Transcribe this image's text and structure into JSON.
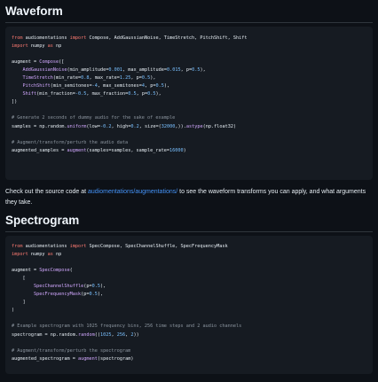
{
  "waveform": {
    "heading": "Waveform",
    "code": {
      "l1": {
        "kw1": "from",
        "mod": "audiomentations",
        "kw2": "import",
        "names": "Compose, AddGaussianNoise, TimeStretch, PitchShift, Shift"
      },
      "l2": {
        "kw1": "import",
        "mod": "numpy",
        "kw2": "as",
        "alias": "np"
      },
      "l4": {
        "lhs": "augment = ",
        "fn": "Compose",
        "rest": "(["
      },
      "l5": {
        "fn": "AddGaussianNoise",
        "a1": "(min_amplitude=",
        "n1": "0.001",
        "a2": ", max_amplitude=",
        "n2": "0.015",
        "a3": ", p=",
        "n3": "0.5",
        "end": "),"
      },
      "l6": {
        "fn": "TimeStretch",
        "a1": "(min_rate=",
        "n1": "0.8",
        "a2": ", max_rate=",
        "n2": "1.25",
        "a3": ", p=",
        "n3": "0.5",
        "end": "),"
      },
      "l7": {
        "fn": "PitchShift",
        "a1": "(min_semitones=",
        "n1": "-4",
        "a2": ", max_semitones=",
        "n2": "4",
        "a3": ", p=",
        "n3": "0.5",
        "end": "),"
      },
      "l8": {
        "fn": "Shift",
        "a1": "(min_fraction=",
        "n1": "-0.5",
        "a2": ", max_fraction=",
        "n2": "0.5",
        "a3": ", p=",
        "n3": "0.5",
        "end": "),"
      },
      "l9": "])",
      "l11": "# Generate 2 seconds of dummy audio for the sake of example",
      "l12": {
        "a": "samples = np.random.",
        "fn": "uniform",
        "b": "(low=",
        "n1": "-0.2",
        "c": ", high=",
        "n2": "0.2",
        "d": ", size=(",
        "n3": "32000",
        "e": ",)).",
        "fn2": "astype",
        "f": "(np.float32)"
      },
      "l14": "# Augment/transform/perturb the audio data",
      "l15": {
        "a": "augmented_samples = ",
        "fn": "augment",
        "b": "(samples=samples, sample_rate=",
        "n": "16000",
        "c": ")"
      }
    },
    "prose": {
      "before": "Check out the source code at ",
      "link": "audiomentations/augmentations/",
      "after": " to see the waveform transforms you can apply, and what arguments they take."
    }
  },
  "spectrogram": {
    "heading": "Spectrogram",
    "code": {
      "l1": {
        "kw1": "from",
        "mod": "audiomentations",
        "kw2": "import",
        "names": "SpecCompose, SpecChannelShuffle, SpecFrequencyMask"
      },
      "l2": {
        "kw1": "import",
        "mod": "numpy",
        "kw2": "as",
        "alias": "np"
      },
      "l4": {
        "lhs": "augment = ",
        "fn": "SpecCompose",
        "rest": "("
      },
      "l5": "[",
      "l6": {
        "fn": "SpecChannelShuffle",
        "a": "(p=",
        "n": "0.5",
        "end": "),"
      },
      "l7": {
        "fn": "SpecFrequencyMask",
        "a": "(p=",
        "n": "0.5",
        "end": "),"
      },
      "l8": "]",
      "l9": ")",
      "l11": "# Example spectrogram with 1025 frequency bins, 256 time steps and 2 audio channels",
      "l12": {
        "a": "spectrogram = np.random.",
        "fn": "random",
        "b": "((",
        "n1": "1025",
        "c": ", ",
        "n2": "256",
        "d": ", ",
        "n3": "2",
        "e": "))"
      },
      "l14": "# Augment/transform/perturb the spectrogram",
      "l15": {
        "a": "augmented_spectrogram = ",
        "fn": "augment",
        "b": "(spectrogram)"
      }
    }
  }
}
